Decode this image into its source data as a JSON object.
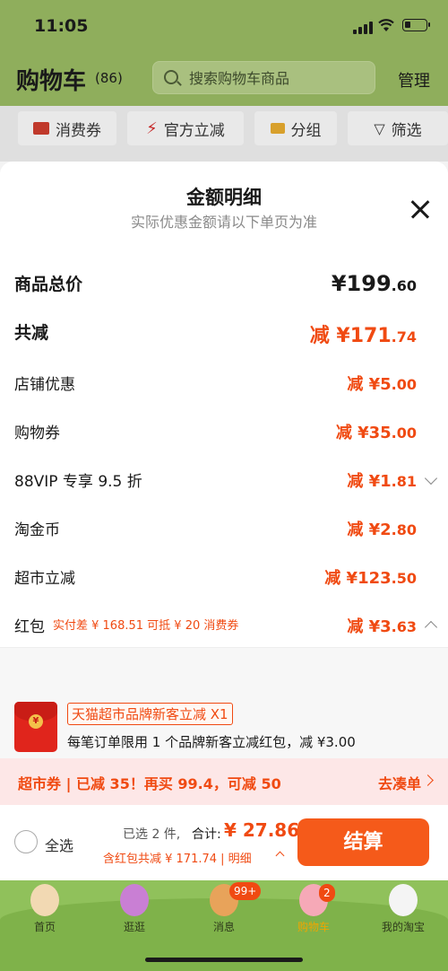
{
  "status": {
    "time": "11:05"
  },
  "header": {
    "title": "购物车",
    "count": "(86)",
    "manage": "管理"
  },
  "search": {
    "placeholder": "搜索购物车商品"
  },
  "filters": [
    "消费券",
    "官方立减",
    "分组",
    "筛选"
  ],
  "sheet": {
    "title": "金额明细",
    "subtitle": "实际优惠金额请以下单页为准",
    "rows": [
      {
        "label": "商品总价",
        "value": "¥199",
        "decimal": ".60"
      },
      {
        "label": "共减",
        "value": "减 ¥171",
        "decimal": ".74"
      },
      {
        "label": "店铺优惠",
        "value": "减 ¥5",
        "decimal": ".00"
      },
      {
        "label": "购物券",
        "value": "减 ¥35",
        "decimal": ".00"
      },
      {
        "label": "88VIP 专享 9.5 折",
        "value": "减 ¥1",
        "decimal": ".81"
      },
      {
        "label": "淘金币",
        "value": "减 ¥2",
        "decimal": ".80"
      },
      {
        "label": "超市立减",
        "value": "减 ¥123",
        "decimal": ".50"
      },
      {
        "label": "红包",
        "value": "减 ¥3",
        "decimal": ".63"
      }
    ],
    "hongbao_note": "实付差 ¥ 168.51 可抵 ¥ 20 消费券",
    "promo": {
      "name": "天猫超市品牌新客立减 X1",
      "desc": "每笔订单限用 1 个品牌新客立减红包，减 ¥3.00"
    }
  },
  "coupon_bar": {
    "text": "超市券 | 已减 35！再买 99.4，可减 50",
    "action": "去凑单"
  },
  "checkout": {
    "select_all": "全选",
    "selected": "已选 2 件,",
    "total_label": "合计:",
    "total": "¥ 27.86",
    "incl": "含红包共减 ¥ 171.74 | 明细",
    "pay": "结算"
  },
  "tabs": [
    {
      "label": "首页",
      "badge": ""
    },
    {
      "label": "逛逛",
      "badge": ""
    },
    {
      "label": "消息",
      "badge": "99+"
    },
    {
      "label": "购物车",
      "badge": "2"
    },
    {
      "label": "我的淘宝",
      "badge": ""
    }
  ],
  "colors": {
    "accent": "#f04a12",
    "header_bg": "#8fae5c",
    "pay": "#f55a1a"
  }
}
